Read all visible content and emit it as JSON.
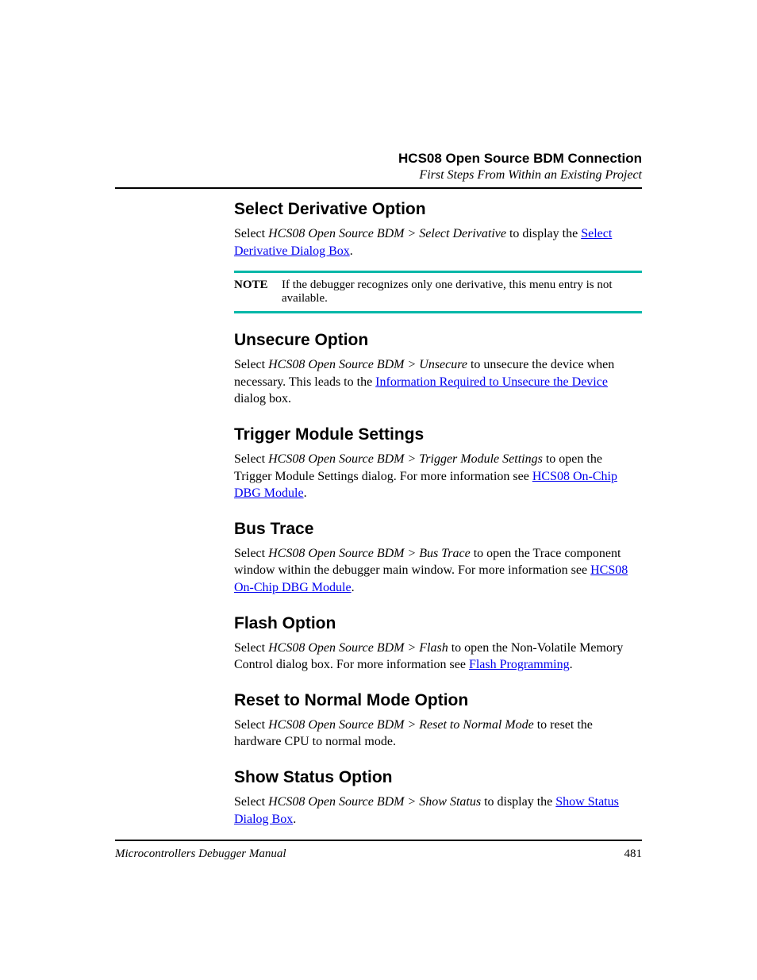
{
  "header": {
    "title": "HCS08 Open Source BDM Connection",
    "subtitle": "First Steps From Within an Existing Project"
  },
  "sections": {
    "s1": {
      "heading": "Select Derivative Option",
      "p1a": "Select ",
      "p1b": "HCS08 Open Source BDM > Select Derivative",
      "p1c": " to display the ",
      "link1": "Select Derivative Dialog Box",
      "p1d": ".",
      "noteLabel": "NOTE",
      "noteText": "If the debugger recognizes only one derivative, this menu entry is not available."
    },
    "s2": {
      "heading": "Unsecure Option",
      "p1a": "Select ",
      "p1b": "HCS08 Open Source BDM > Unsecure",
      "p1c": " to unsecure the device when necessary. This leads to the ",
      "link1": "Information Required to Unsecure the Device",
      "p1d": " dialog box."
    },
    "s3": {
      "heading": "Trigger Module Settings",
      "p1a": "Select ",
      "p1b": "HCS08 Open Source BDM > Trigger Module Settings",
      "p1c": " to open the Trigger Module Settings dialog. For more information see ",
      "link1": "HCS08 On-Chip DBG Module",
      "p1d": "."
    },
    "s4": {
      "heading": "Bus Trace",
      "p1a": "Select ",
      "p1b": "HCS08 Open Source BDM > Bus Trace",
      "p1c": " to open the Trace component window within the debugger main window. For more information see ",
      "link1": "HCS08 On-Chip DBG Module",
      "p1d": "."
    },
    "s5": {
      "heading": "Flash Option",
      "p1a": "Select ",
      "p1b": "HCS08 Open Source BDM > Flash",
      "p1c": " to open the Non-Volatile Memory Control dialog box. For more information see ",
      "link1": "Flash Programming",
      "p1d": "."
    },
    "s6": {
      "heading": "Reset to Normal Mode Option",
      "p1a": "Select ",
      "p1b": "HCS08 Open Source BDM > Reset to Normal Mode",
      "p1c": " to reset the hardware CPU to normal mode."
    },
    "s7": {
      "heading": "Show Status Option",
      "p1a": "Select ",
      "p1b": "HCS08 Open Source BDM > Show Status",
      "p1c": " to display the ",
      "link1": "Show Status Dialog Box",
      "p1d": "."
    }
  },
  "footer": {
    "left": "Microcontrollers Debugger Manual",
    "right": "481"
  }
}
